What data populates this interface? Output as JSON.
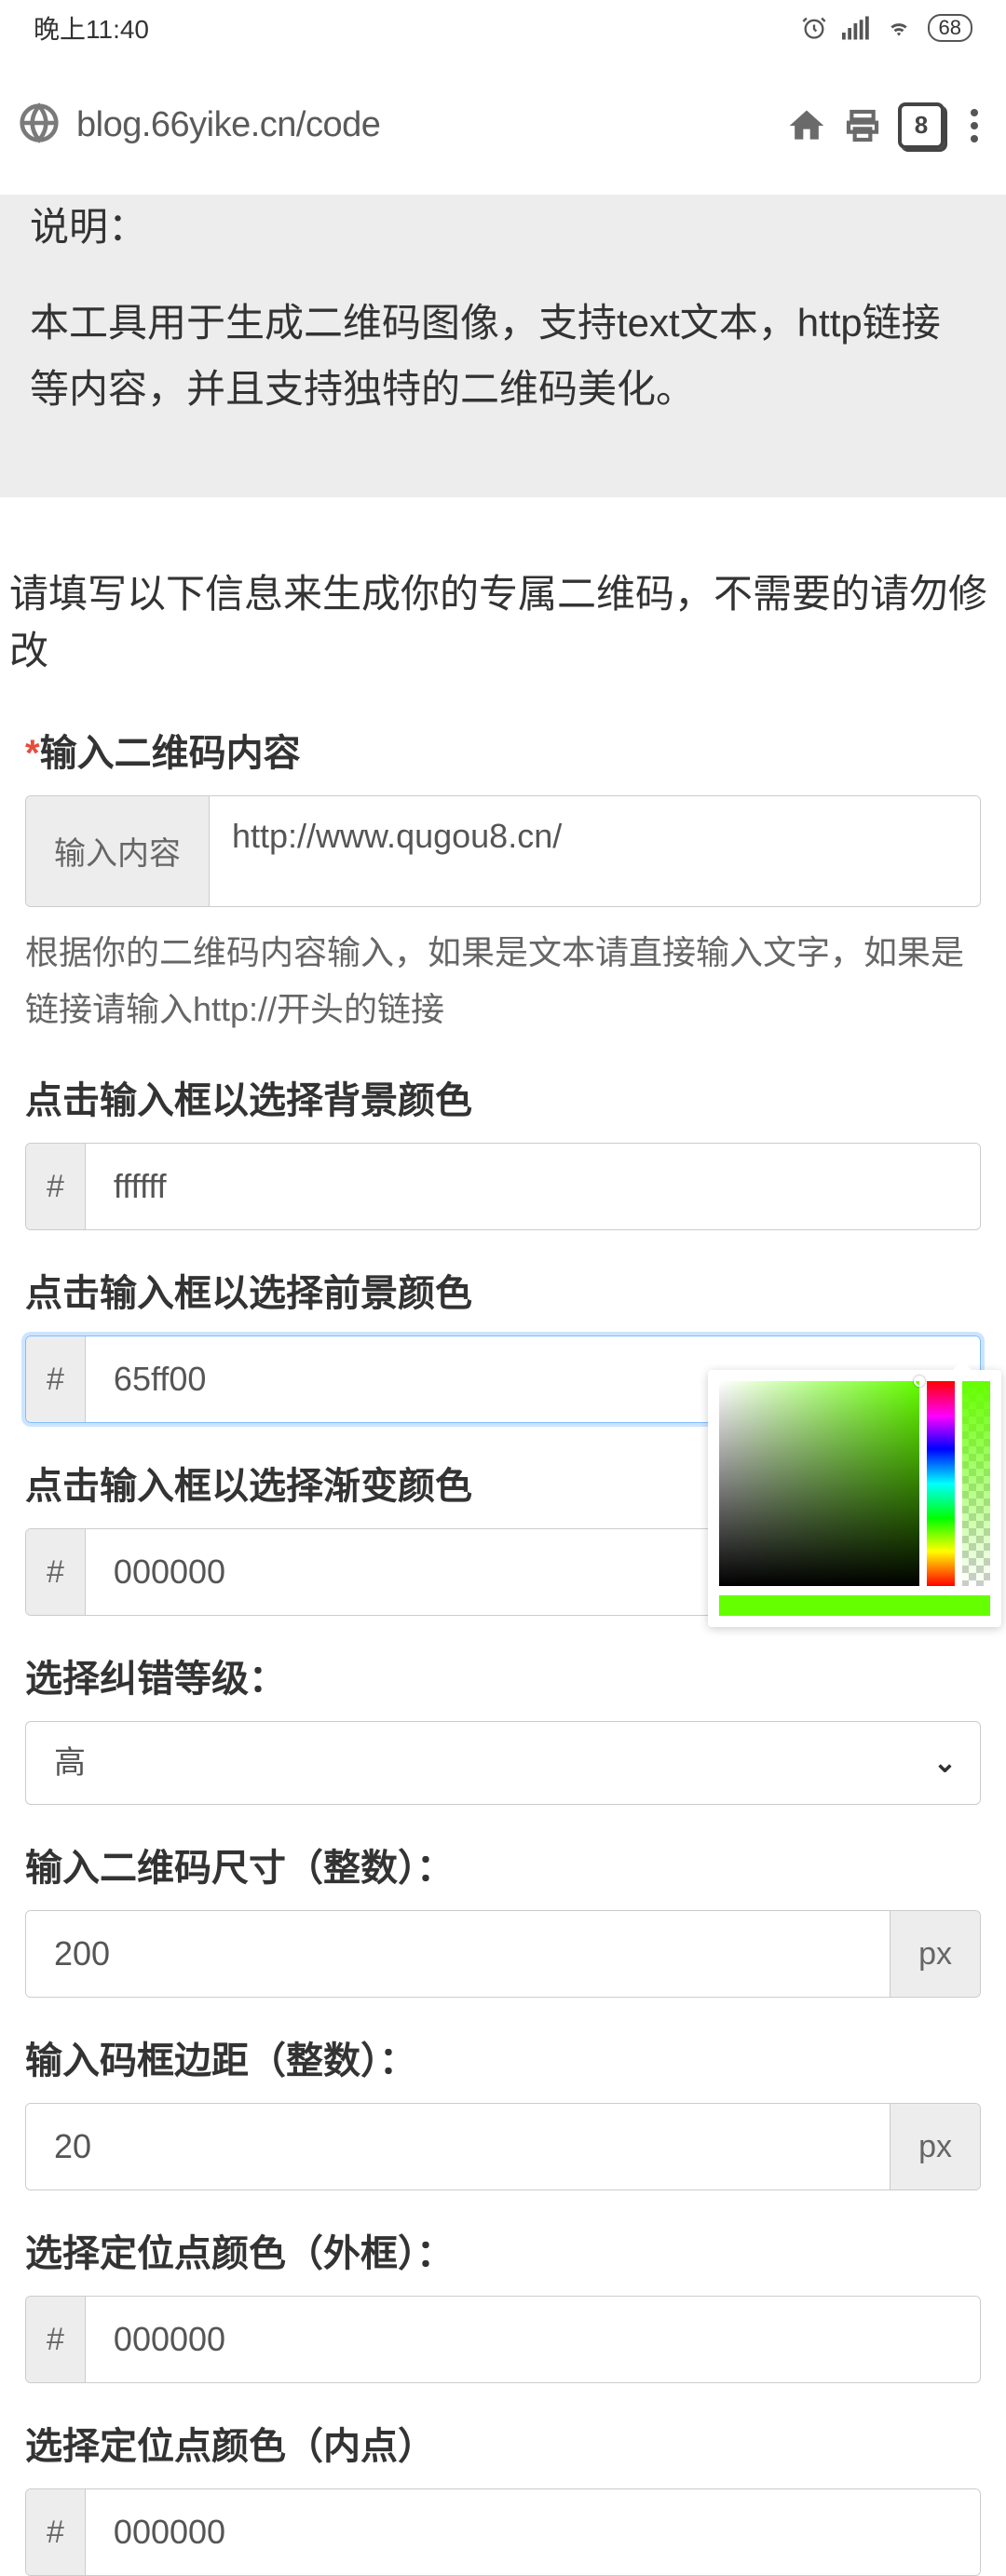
{
  "status_bar": {
    "time": "晚上11:40",
    "battery": "68"
  },
  "browser": {
    "url": "blog.66yike.cn/code",
    "tab_count": "8"
  },
  "description": {
    "title": "说明：",
    "content": "本工具用于生成二维码图像，支持text文本，http链接等内容，并且支持独特的二维码美化。"
  },
  "instruction": "请填写以下信息来生成你的专属二维码，不需要的请勿修改",
  "form": {
    "content": {
      "label": "输入二维码内容",
      "prefix": "输入内容",
      "value": "http://www.qugou8.cn/",
      "help": "根据你的二维码内容输入，如果是文本请直接输入文字，如果是链接请输入http://开头的链接"
    },
    "bg_color": {
      "label": "点击输入框以选择背景颜色",
      "prefix": "#",
      "value": "ffffff"
    },
    "fg_color": {
      "label": "点击输入框以选择前景颜色",
      "prefix": "#",
      "value": "65ff00"
    },
    "gradient_color": {
      "label": "点击输入框以选择渐变颜色",
      "prefix": "#",
      "value": "000000"
    },
    "error_level": {
      "label": "选择纠错等级：",
      "value": "高"
    },
    "size": {
      "label": "输入二维码尺寸（整数）：",
      "value": "200",
      "suffix": "px"
    },
    "margin": {
      "label": "输入码框边距（整数）：",
      "value": "20",
      "suffix": "px"
    },
    "pt_outer": {
      "label": "选择定位点颜色（外框）：",
      "prefix": "#",
      "value": "000000"
    },
    "pt_inner": {
      "label": "选择定位点颜色（内点）",
      "prefix": "#",
      "value": "000000"
    }
  }
}
